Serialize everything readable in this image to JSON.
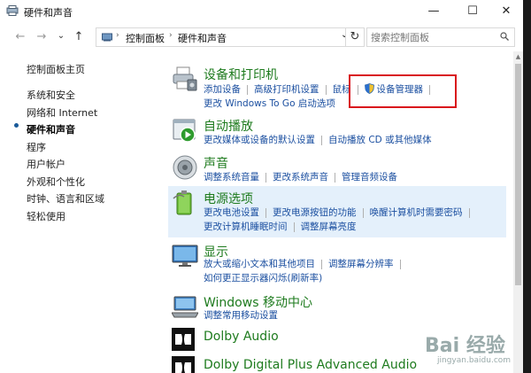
{
  "window": {
    "title": "硬件和声音",
    "minimize": "—",
    "maximize": "☐",
    "close": "✕"
  },
  "nav": {
    "back": "←",
    "forward": "→",
    "recent": "⌄",
    "up": "↑",
    "breadcrumb": [
      "控制面板",
      "硬件和声音"
    ],
    "crumb_sep": "›",
    "dropdown": "⌄",
    "refresh": "↻",
    "search_placeholder": "搜索控制面板"
  },
  "sidebar": {
    "items": [
      {
        "label": "控制面板主页",
        "active": false
      },
      {
        "label": "系统和安全",
        "active": false
      },
      {
        "label": "网络和 Internet",
        "active": false
      },
      {
        "label": "硬件和声音",
        "active": true
      },
      {
        "label": "程序",
        "active": false
      },
      {
        "label": "用户帐户",
        "active": false
      },
      {
        "label": "外观和个性化",
        "active": false
      },
      {
        "label": "时钟、语言和区域",
        "active": false
      },
      {
        "label": "轻松使用",
        "active": false
      }
    ]
  },
  "categories": [
    {
      "title": "设备和打印机",
      "icon": "printer-icon",
      "rows": [
        [
          "添加设备",
          "高级打印机设置",
          "鼠标",
          "设备管理器"
        ],
        [
          "更改 Windows To Go 启动选项"
        ]
      ]
    },
    {
      "title": "自动播放",
      "icon": "autoplay-icon",
      "rows": [
        [
          "更改媒体或设备的默认设置",
          "自动播放 CD 或其他媒体"
        ]
      ]
    },
    {
      "title": "声音",
      "icon": "speaker-icon",
      "rows": [
        [
          "调整系统音量",
          "更改系统声音",
          "管理音频设备"
        ]
      ]
    },
    {
      "title": "电源选项",
      "icon": "battery-icon",
      "rows": [
        [
          "更改电池设置",
          "更改电源按钮的功能",
          "唤醒计算机时需要密码"
        ],
        [
          "更改计算机睡眠时间",
          "调整屏幕亮度"
        ]
      ]
    },
    {
      "title": "显示",
      "icon": "monitor-icon",
      "rows": [
        [
          "放大或缩小文本和其他项目",
          "调整屏幕分辨率"
        ],
        [
          "如何更正显示器闪烁(刷新率)"
        ]
      ]
    },
    {
      "title": "Windows 移动中心",
      "icon": "mobility-center-icon",
      "rows": [
        [
          "调整常用移动设置"
        ]
      ]
    },
    {
      "title": "Dolby Audio",
      "icon": "dolby-icon",
      "rows": []
    },
    {
      "title": "Dolby Digital Plus Advanced Audio",
      "icon": "dolby-icon",
      "rows": []
    }
  ],
  "watermark": {
    "brand": "Bai 经验",
    "url": "jingyan.baidu.com"
  }
}
